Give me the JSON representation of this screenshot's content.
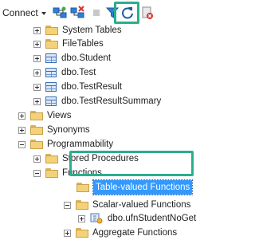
{
  "toolbar": {
    "connect_label": "Connect",
    "buttons": [
      {
        "name": "connect-object-explorer-icon"
      },
      {
        "name": "disconnect-icon"
      },
      {
        "name": "stop-icon"
      },
      {
        "name": "filter-icon"
      },
      {
        "name": "refresh-icon"
      },
      {
        "name": "new-query-clear-filter-icon"
      }
    ],
    "highlight_color": "#2bae8c"
  },
  "tree": {
    "nodes": [
      {
        "label": "System Tables",
        "icon": "folder-icon",
        "expander": "plus"
      },
      {
        "label": "FileTables",
        "icon": "folder-icon",
        "expander": "plus"
      },
      {
        "label": "dbo.Student",
        "icon": "table-icon",
        "expander": "plus"
      },
      {
        "label": "dbo.Test",
        "icon": "table-icon",
        "expander": "plus"
      },
      {
        "label": "dbo.TestResult",
        "icon": "table-icon",
        "expander": "plus"
      },
      {
        "label": "dbo.TestResultSummary",
        "icon": "table-icon",
        "expander": "plus"
      },
      {
        "label": "Views",
        "icon": "folder-icon",
        "expander": "plus"
      },
      {
        "label": "Synonyms",
        "icon": "folder-icon",
        "expander": "plus"
      },
      {
        "label": "Programmability",
        "icon": "folder-icon",
        "expander": "minus"
      },
      {
        "label": "Stored Procedures",
        "icon": "folder-icon",
        "expander": "plus"
      },
      {
        "label": "Functions",
        "icon": "folder-icon",
        "expander": "minus"
      },
      {
        "label": "Table-valued Functions",
        "icon": "folder-icon",
        "expander": "none",
        "selected": true
      },
      {
        "label": "Scalar-valued Functions",
        "icon": "folder-icon",
        "expander": "minus"
      },
      {
        "label": "dbo.ufnStudentNoGet",
        "icon": "function-icon",
        "expander": "plus"
      },
      {
        "label": "Aggregate Functions",
        "icon": "folder-icon",
        "expander": "plus"
      }
    ],
    "selection_color": "#3399ff"
  }
}
